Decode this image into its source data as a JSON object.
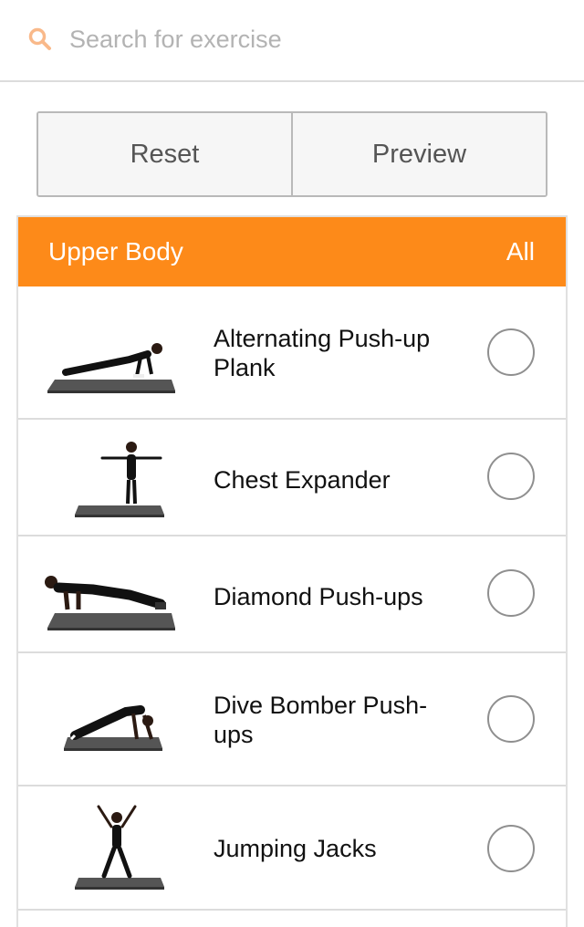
{
  "search": {
    "placeholder": "Search for exercise",
    "icon": "search-icon",
    "icon_color": "#f9b98a"
  },
  "buttons": {
    "reset_label": "Reset",
    "preview_label": "Preview"
  },
  "section": {
    "title": "Upper Body",
    "all_label": "All",
    "header_color": "#fd8a19"
  },
  "exercises": [
    {
      "name": "Alternating Push-up Plank",
      "selected": false
    },
    {
      "name": "Chest Expander",
      "selected": false
    },
    {
      "name": "Diamond Push-ups",
      "selected": false
    },
    {
      "name": "Dive Bomber Push-ups",
      "selected": false
    },
    {
      "name": "Jumping Jacks",
      "selected": false
    }
  ]
}
